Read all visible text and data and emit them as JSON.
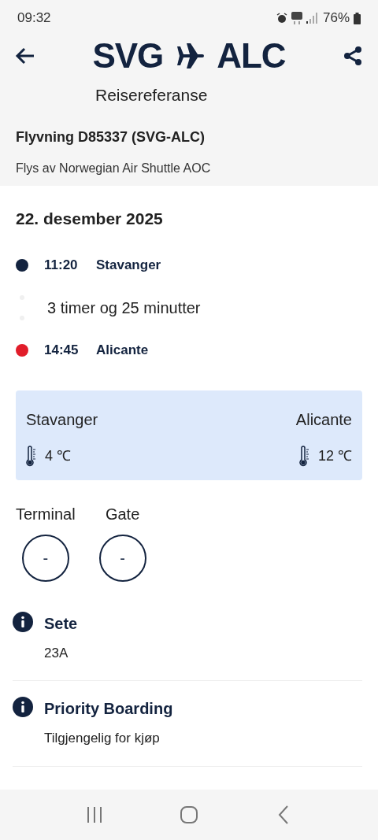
{
  "status_bar": {
    "time": "09:32",
    "battery": "76%"
  },
  "header": {
    "origin": "SVG",
    "destination": "ALC",
    "reference_label": "Reisereferanse"
  },
  "flight": {
    "title": "Flyvning D85337 (SVG-ALC)",
    "operator": "Flys av Norwegian Air Shuttle AOC"
  },
  "date": "22. desember 2025",
  "itinerary": [
    {
      "kind": "stop",
      "time": "11:20",
      "place": "Stavanger",
      "color": "#13233f"
    },
    {
      "kind": "duration",
      "text": "3 timer og 25 minutter"
    },
    {
      "kind": "stop",
      "time": "14:45",
      "place": "Alicante",
      "color": "#e11d2a"
    }
  ],
  "weather": [
    {
      "city": "Stavanger",
      "temperature": "4 ℃"
    },
    {
      "city": "Alicante",
      "temperature": "12 ℃"
    }
  ],
  "gates": [
    {
      "label": "Terminal",
      "value": "-"
    },
    {
      "label": "Gate",
      "value": "-"
    }
  ],
  "info": [
    {
      "title": "Sete",
      "detail": "23A"
    },
    {
      "title": "Priority Boarding",
      "detail": "Tilgjengelig for kjøp"
    }
  ]
}
